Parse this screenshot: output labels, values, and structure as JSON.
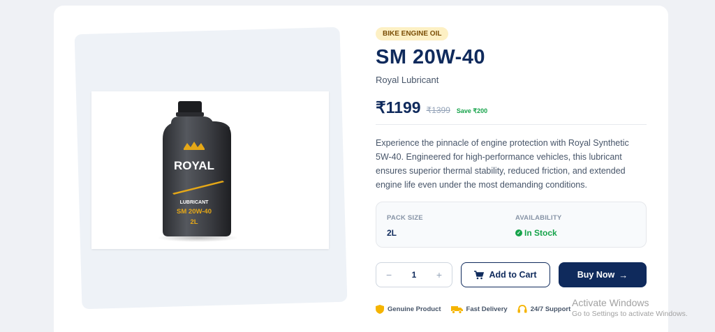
{
  "product": {
    "category_badge": "BIKE ENGINE OIL",
    "name": "SM 20W-40",
    "brand": "Royal Lubricant",
    "price": "₹1199",
    "original_price": "₹1399",
    "savings": "Save ₹200",
    "description": "Experience the pinnacle of engine protection with Royal Synthetic 5W-40. Engineered for high-performance vehicles, this lubricant ensures superior thermal stability, reduced friction, and extended engine life even under the most demanding conditions."
  },
  "image": {
    "brand_text": "ROYAL",
    "line1": "LUBRICANT",
    "line2": "SM 20W-40",
    "line3": "2L"
  },
  "specs": {
    "pack_size_label": "PACK SIZE",
    "pack_size_value": "2L",
    "availability_label": "AVAILABILITY",
    "availability_value": "In Stock"
  },
  "actions": {
    "quantity": "1",
    "decrement": "−",
    "increment": "+",
    "add_to_cart": "Add to Cart",
    "buy_now": "Buy Now"
  },
  "features": [
    {
      "label": "Genuine Product",
      "icon": "shield-icon"
    },
    {
      "label": "Fast Delivery",
      "icon": "truck-icon"
    },
    {
      "label": "24/7 Support",
      "icon": "headset-icon"
    }
  ],
  "watermark": {
    "line1": "Activate Windows",
    "line2": "Go to Settings to activate Windows."
  },
  "colors": {
    "primary": "#0f2a5c",
    "success": "#16a34a",
    "badge_bg": "#fdf0c4",
    "accent_gold": "#e6a817"
  }
}
